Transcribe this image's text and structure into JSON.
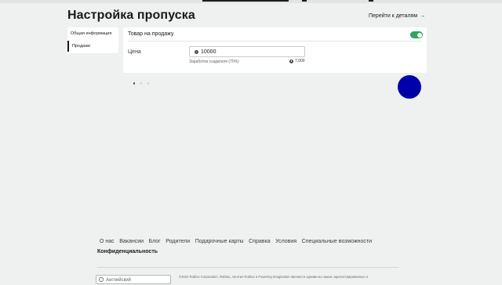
{
  "header": {
    "title": "Настройка пропуска",
    "details_link": "Перейти к деталям",
    "details_arrow": "→"
  },
  "sidebar": {
    "items": [
      {
        "label": "Общая информация",
        "active": false
      },
      {
        "label": "Продажи",
        "active": true
      }
    ]
  },
  "sales": {
    "for_sale_label": "Товар на продажу",
    "for_sale_enabled": true,
    "price_label": "Цена",
    "price_value": "10000",
    "earnings_label": "Заработок создателя (70%)",
    "earnings_value": "7,000",
    "currency_icon": "robux-icon"
  },
  "pagination": {
    "pages": 3,
    "current": 1
  },
  "footer": {
    "links": [
      "О нас",
      "Вакансии",
      "Блог",
      "Родители",
      "Подарочные карты",
      "Справка",
      "Условия",
      "Специальные возможности"
    ],
    "privacy": "Конфиденциальность",
    "language": "Английский",
    "copyright": "©2022 Roblox Corporation. Roblox, логотип Roblox и Powering Imagination являются одними из наших зарегистрированных и"
  },
  "colors": {
    "accent_green": "#30a45c",
    "overlay_circle": "#0000a8",
    "background": "#eff0f0"
  }
}
